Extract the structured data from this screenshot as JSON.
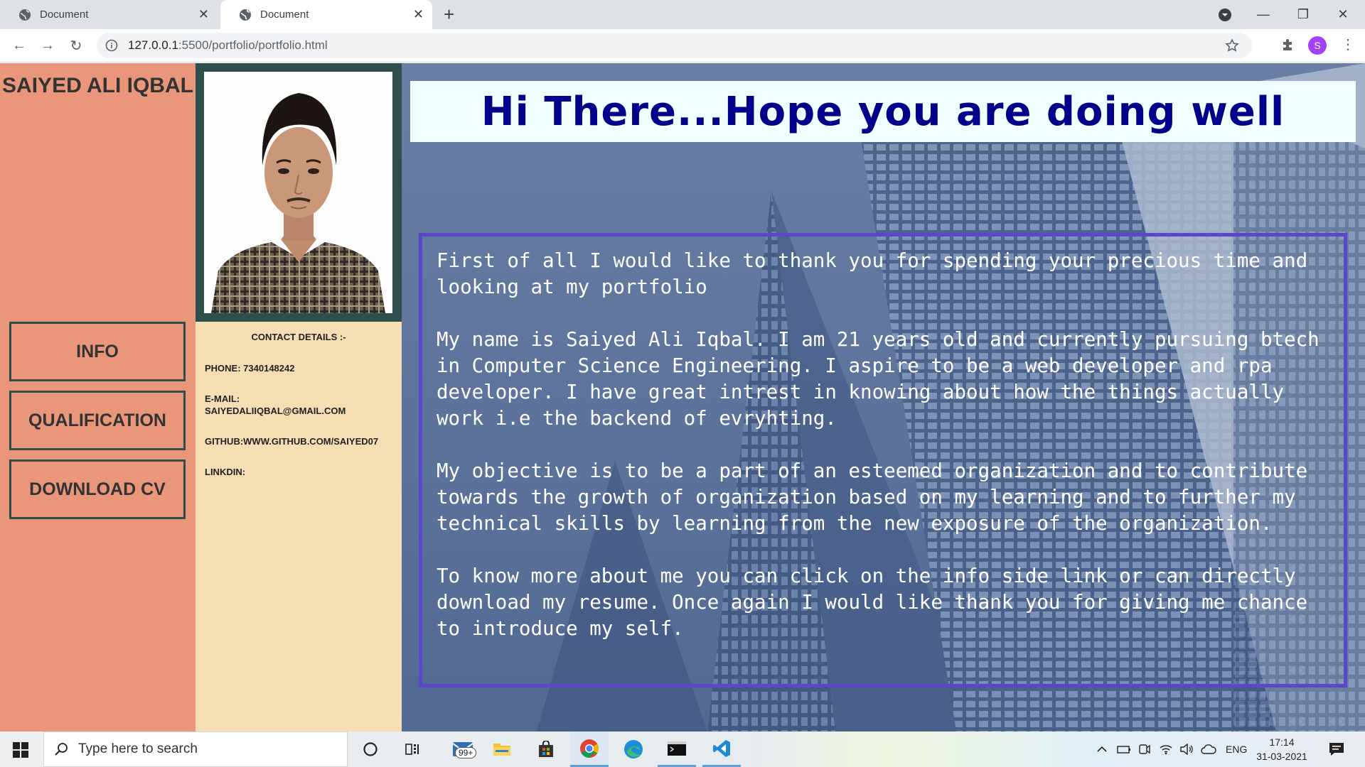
{
  "browser": {
    "tabs": [
      {
        "title": "Document"
      },
      {
        "title": "Document"
      }
    ],
    "url_host": "127.0.0.1",
    "url_rest": ":5500/portfolio/portfolio.html",
    "profile_initial": "S"
  },
  "sidebar": {
    "name": "SAIYED ALI IQBAL",
    "nav": [
      "INFO",
      "QUALIFICATION",
      "DOWNLOAD CV"
    ]
  },
  "contact": {
    "title": "CONTACT DETAILS :-",
    "phone": "PHONE: 7340148242",
    "email_label": "E-MAIL:",
    "email": "SAIYEDALIIQBAL@GMAIL.COM",
    "github": "GITHUB:WWW.GITHUB.COM/SAIYED07",
    "linkedin": "LINKDIN:"
  },
  "main": {
    "heading": "Hi There...Hope you are doing well",
    "paragraphs": [
      "First of all I would like to thank you for spending your precious time and looking at my portfolio",
      "My name is Saiyed Ali Iqbal. I am 21 years old and currently pursuing btech in Computer Science Engineering. I aspire to be a web developer and rpa developer. I have great intrest in knowing about how the things actually work i.e the backend of evryhting.",
      "My objective is to be a part of an esteemed organization and to contribute towards the growth of organization based on my learning and to further my technical skills by learning from the new exposure of the organization.",
      "To know more about me you can click on the info side link or can directly download my resume. Once again I would like thank you for giving me chance to introduce my self."
    ]
  },
  "taskbar": {
    "search_placeholder": "Type here to search",
    "mail_badge": "99+",
    "language": "ENG",
    "time": "17:14",
    "date": "31-03-2021"
  }
}
